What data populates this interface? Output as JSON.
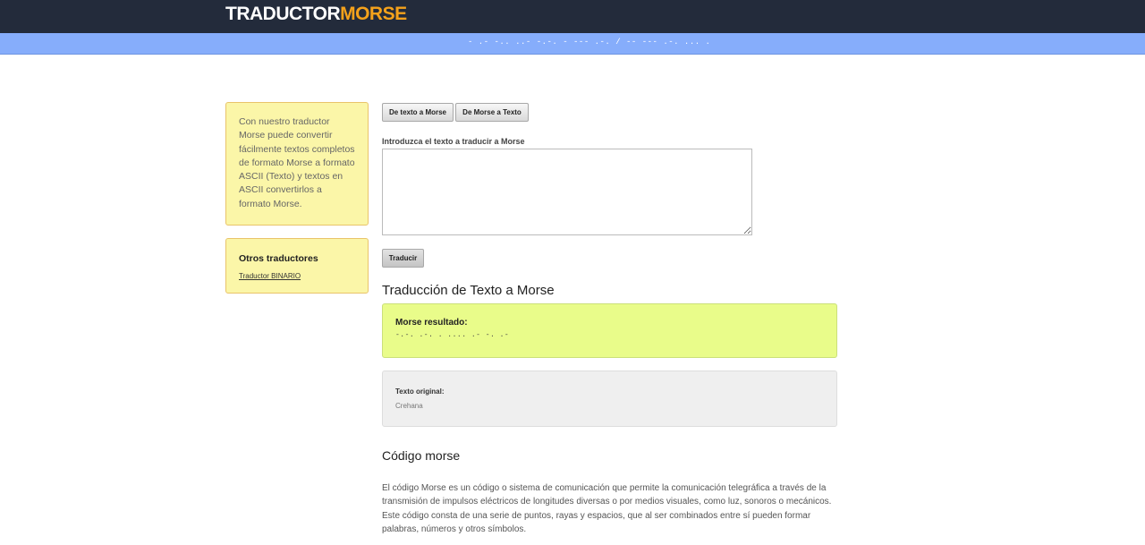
{
  "header": {
    "logo_white": "TRADUCTOR",
    "logo_orange": "MORSE",
    "bg_color": "#232b3b",
    "accent_color": "#f5a21b"
  },
  "subbar": {
    "morse_text": "- .- -.. ..- -.-. - --- .-. / -- --- .-. ... ."
  },
  "sidebar": {
    "info_text": "Con nuestro traductor Morse puede convertir fácilmente textos completos de formato Morse a formato ASCII (Texto) y textos en ASCII convertirlos a formato Morse.",
    "others_title": "Otros traductores",
    "others_link": "Traductor BINARIO"
  },
  "main": {
    "tab_text_to_morse": "De texto a Morse",
    "tab_morse_to_text": "De Morse a Texto",
    "input_label": "Introduzca el texto a traducir a Morse",
    "input_value": "",
    "translate_button": "Traducir",
    "translation_title": "Traducción de Texto a Morse",
    "result_label": "Morse resultado:",
    "result_value": "-.-. .-. . .... .- -. .-",
    "original_label": "Texto original:",
    "original_value": "Crehana",
    "section_title": "Código morse",
    "section_text": "El código Morse es un código o sistema de comunicación que permite la comunicación telegráfica a través de la transmisión de impulsos eléctricos de longitudes diversas o por medios visuales, como luz, sonoros o mecánicos. Este código consta de una serie de puntos, rayas y espacios, que al ser combinados entre sí pueden formar palabras, números y otros símbolos."
  }
}
